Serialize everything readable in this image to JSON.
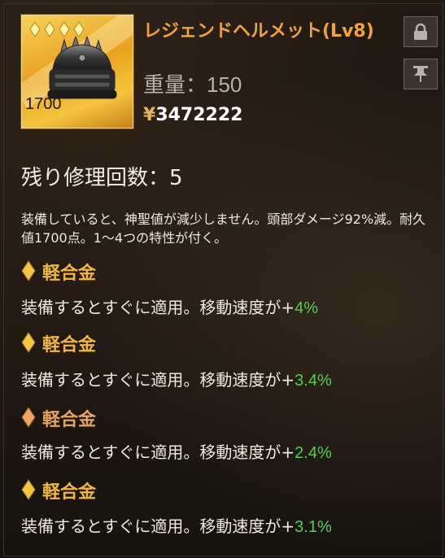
{
  "item": {
    "name": "レジェンドヘルメット(Lv8)",
    "durability_badge": "1700",
    "weight_label": "重量：",
    "weight_value": "150",
    "price": "3472222",
    "currency_symbol": "¥",
    "stars": 4,
    "rarity_color": "#f3c43f"
  },
  "buttons": {
    "lock_icon": "lock-icon",
    "pin_icon": "pin-icon"
  },
  "repair": {
    "label": "残り修理回数：5"
  },
  "description": "装備していると、神聖値が減少しません。頭部ダメージ92%減。耐久値1700点。1～4つの特性が付く。",
  "traits": [
    {
      "name": "軽合金",
      "text": "装備するとすぐに適用。移動速度が+",
      "value": "4%"
    },
    {
      "name": "軽合金",
      "text": "装備するとすぐに適用。移動速度が+",
      "value": "3.4%"
    },
    {
      "name": "軽合金",
      "text": "装備するとすぐに適用。移動速度が+",
      "value": "2.4%"
    },
    {
      "name": "軽合金",
      "text": "装備するとすぐに適用。移動速度が+",
      "value": "3.1%"
    }
  ],
  "colors": {
    "title": "#f3a23a",
    "trait_title": "#f2b63c",
    "trait_value": "#4fd14a"
  }
}
